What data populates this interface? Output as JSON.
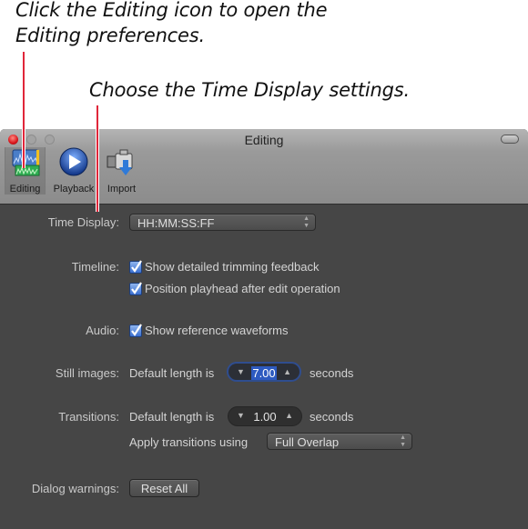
{
  "annotations": {
    "callout_editing": "Click the Editing icon to open the Editing preferences.",
    "callout_time_display": "Choose the Time Display settings.",
    "line_color": "#e0263a"
  },
  "window": {
    "title": "Editing",
    "toolbar": [
      {
        "label": "Editing",
        "icon": "editing-icon",
        "selected": true
      },
      {
        "label": "Playback",
        "icon": "playback-icon",
        "selected": false
      },
      {
        "label": "Import",
        "icon": "import-icon",
        "selected": false
      }
    ]
  },
  "settings": {
    "time_display": {
      "label": "Time Display:",
      "value": "HH:MM:SS:FF"
    },
    "timeline": {
      "label": "Timeline:",
      "options": [
        {
          "label": "Show detailed trimming feedback",
          "checked": true
        },
        {
          "label": "Position playhead after edit operation",
          "checked": true
        }
      ]
    },
    "audio": {
      "label": "Audio:",
      "options": [
        {
          "label": "Show reference waveforms",
          "checked": true
        }
      ]
    },
    "still_images": {
      "label": "Still images:",
      "prefix": "Default length is",
      "value": "7.00",
      "suffix": "seconds"
    },
    "transitions": {
      "label": "Transitions:",
      "prefix": "Default length is",
      "value": "1.00",
      "suffix": "seconds",
      "apply_label": "Apply transitions using",
      "apply_value": "Full Overlap"
    },
    "dialog_warnings": {
      "label": "Dialog warnings:",
      "button": "Reset All"
    }
  }
}
